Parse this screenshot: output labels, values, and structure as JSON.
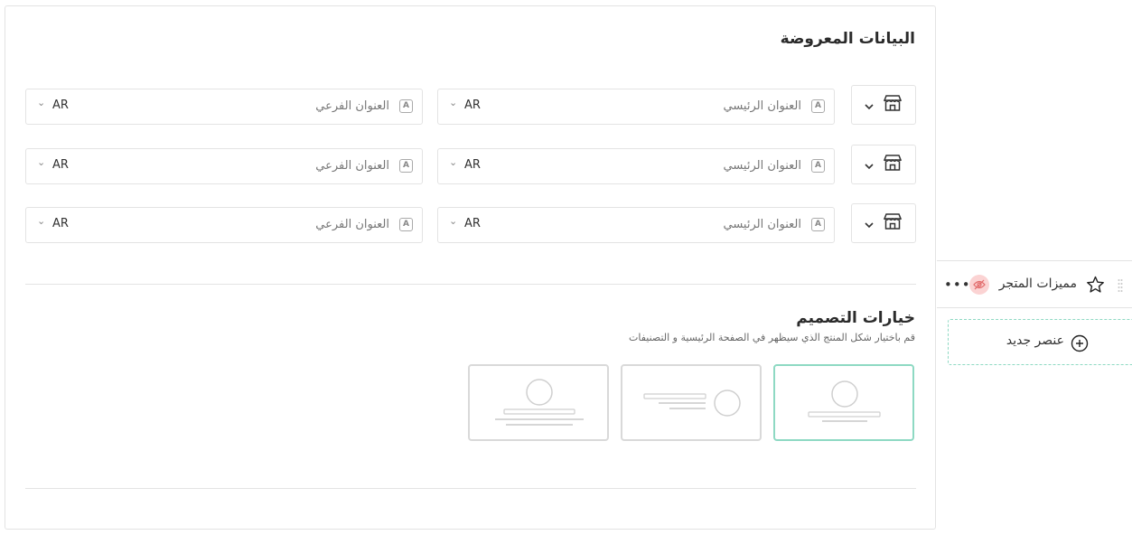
{
  "displayed_data": {
    "title": "البيانات المعروضة",
    "rows": [
      {
        "main_label": "العنوان الرئيسي",
        "main_lang": "AR",
        "sub_label": "العنوان الفرعي",
        "sub_lang": "AR"
      },
      {
        "main_label": "العنوان الرئيسي",
        "main_lang": "AR",
        "sub_label": "العنوان الفرعي",
        "sub_lang": "AR"
      },
      {
        "main_label": "العنوان الرئيسي",
        "main_lang": "AR",
        "sub_label": "العنوان الفرعي",
        "sub_lang": "AR"
      }
    ],
    "text_icon": "A"
  },
  "design_options": {
    "title": "خيارات التصميم",
    "description": "قم باختيار شكل المنتج الذي سيظهر في الصفحة الرئيسية و التصنيفات",
    "selected_index": 0
  },
  "sidebar": {
    "item_label": "مميزات المتجر",
    "add_label": "عنصر جديد"
  },
  "colors": {
    "accent": "#8ed9c3",
    "hidden_badge_bg": "#fbd3d3",
    "hidden_badge_icon": "#e26b6b"
  }
}
